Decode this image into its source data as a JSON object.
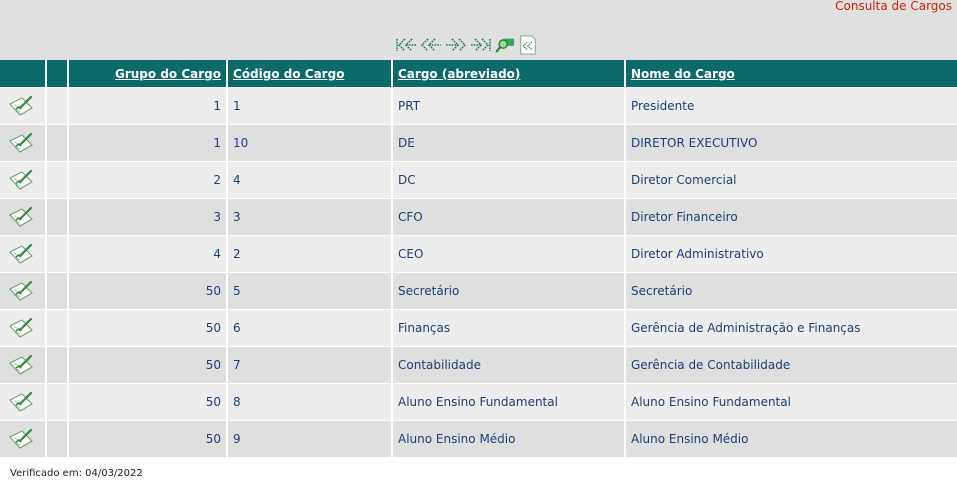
{
  "header": {
    "title": "Consulta de Cargos"
  },
  "toolbar": {
    "icons": [
      "first-page-icon",
      "previous-page-icon",
      "next-page-icon",
      "last-page-icon",
      "search-icon",
      "back-icon"
    ]
  },
  "table": {
    "columns": {
      "group": "Grupo do Cargo",
      "code": "Código do Cargo",
      "abbr": "Cargo (abreviado)",
      "name": "Nome do Cargo"
    },
    "rows": [
      {
        "group": "1",
        "code": "1",
        "abbr": "PRT",
        "name": "Presidente"
      },
      {
        "group": "1",
        "code": "10",
        "abbr": "DE",
        "name": "DIRETOR EXECUTIVO"
      },
      {
        "group": "2",
        "code": "4",
        "abbr": "DC",
        "name": "Diretor Comercial"
      },
      {
        "group": "3",
        "code": "3",
        "abbr": "CFO",
        "name": "Diretor Financeiro"
      },
      {
        "group": "4",
        "code": "2",
        "abbr": "CEO",
        "name": "Diretor Administrativo"
      },
      {
        "group": "50",
        "code": "5",
        "abbr": "Secretário",
        "name": "Secretário"
      },
      {
        "group": "50",
        "code": "6",
        "abbr": "Finanças",
        "name": "Gerência de Administração e Finanças"
      },
      {
        "group": "50",
        "code": "7",
        "abbr": "Contabilidade",
        "name": "Gerência de Contabilidade"
      },
      {
        "group": "50",
        "code": "8",
        "abbr": "Aluno Ensino Fundamental",
        "name": "Aluno Ensino Fundamental"
      },
      {
        "group": "50",
        "code": "9",
        "abbr": "Aluno Ensino Médio",
        "name": "Aluno Ensino Médio"
      }
    ]
  },
  "footer": {
    "verified": "Verificado em: 04/03/2022"
  },
  "colors": {
    "header_bg": "#0b6b6a",
    "title": "#cc2200",
    "link_text": "#1c3f78",
    "row_odd": "#ededed",
    "row_even": "#dfdfdf"
  }
}
